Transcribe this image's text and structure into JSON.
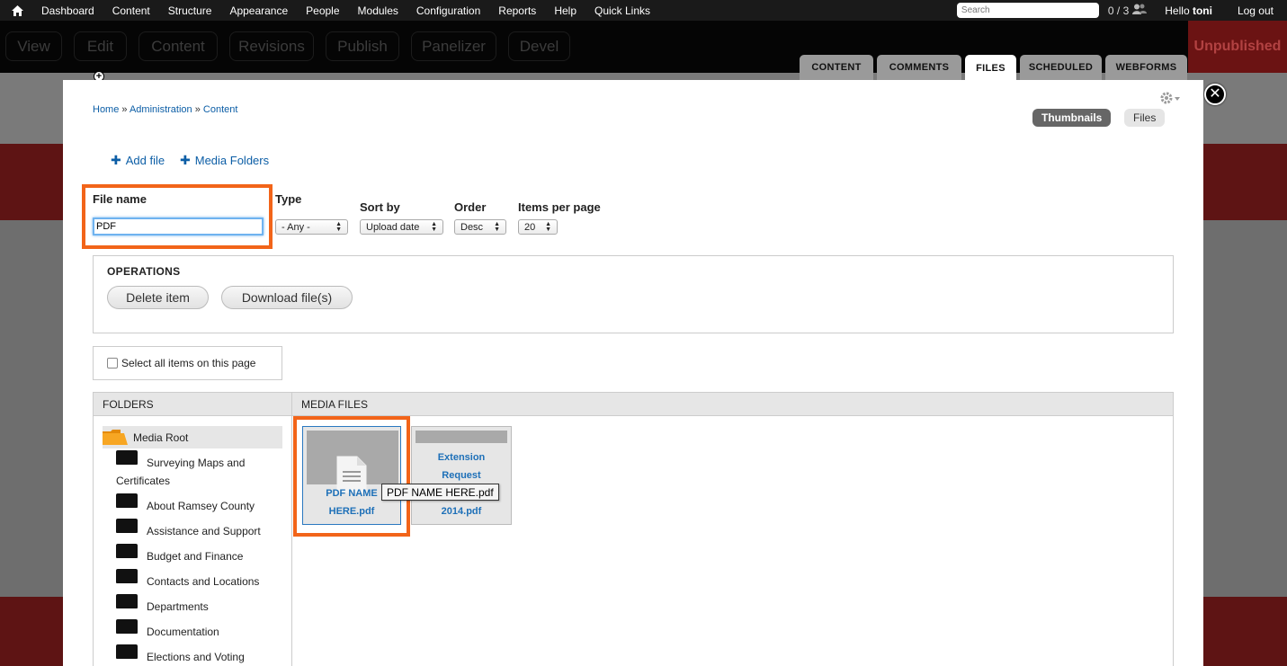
{
  "toolbar": {
    "menu": [
      "Dashboard",
      "Content",
      "Structure",
      "Appearance",
      "People",
      "Modules",
      "Configuration",
      "Reports",
      "Help",
      "Quick Links"
    ],
    "search_placeholder": "Search",
    "counter": "0 / 3",
    "hello": "Hello ",
    "username": "toni",
    "logout": "Log out"
  },
  "shortcuts": {
    "view": "View",
    "edit": "Edit",
    "content": "Content",
    "revisions": "Revisions",
    "publish": "Publish",
    "panelizer": "Panelizer",
    "devel": "Devel",
    "status": "Unpublished"
  },
  "tabs": {
    "content": "CONTENT",
    "comments": "COMMENTS",
    "files": "FILES",
    "scheduled": "SCHEDULED",
    "webforms": "WEBFORMS"
  },
  "breadcrumb": {
    "home": "Home",
    "admin": "Administration",
    "content": "Content",
    "sep": " » "
  },
  "view_toggle": {
    "thumbnails": "Thumbnails",
    "files": "Files"
  },
  "actions": {
    "add_file": "Add file",
    "media_folders": "Media Folders"
  },
  "filters": {
    "file_name_label": "File name",
    "file_name_value": "PDF",
    "type_label": "Type",
    "type_value": "- Any -",
    "sort_label": "Sort by",
    "sort_value": "Upload date",
    "order_label": "Order",
    "order_value": "Desc",
    "items_label": "Items per page",
    "items_value": "20"
  },
  "operations": {
    "title": "OPERATIONS",
    "delete": "Delete item",
    "download": "Download file(s)"
  },
  "select_all": "Select all items on this page",
  "browser": {
    "folders_head": "FOLDERS",
    "media_head": "MEDIA FILES",
    "root": "Media Root",
    "folder1_line1": "Surveying Maps and",
    "folder1_line2": "Certificates",
    "folders": [
      "About Ramsey County",
      "Assistance and Support",
      "Budget and Finance",
      "Contacts and Locations",
      "Departments",
      "Documentation",
      "Elections and Voting"
    ]
  },
  "files": {
    "file1_line1": "PDF NAME",
    "file1_line2": "HERE.pdf",
    "file2_line1": "Extension",
    "file2_line2": "Request",
    "file2_line3": "2014.pdf",
    "tooltip": "PDF NAME HERE.pdf"
  },
  "colors": {
    "highlight": "#f26419",
    "link": "#0c5ea6",
    "unpublished_bg": "#6b1313"
  }
}
